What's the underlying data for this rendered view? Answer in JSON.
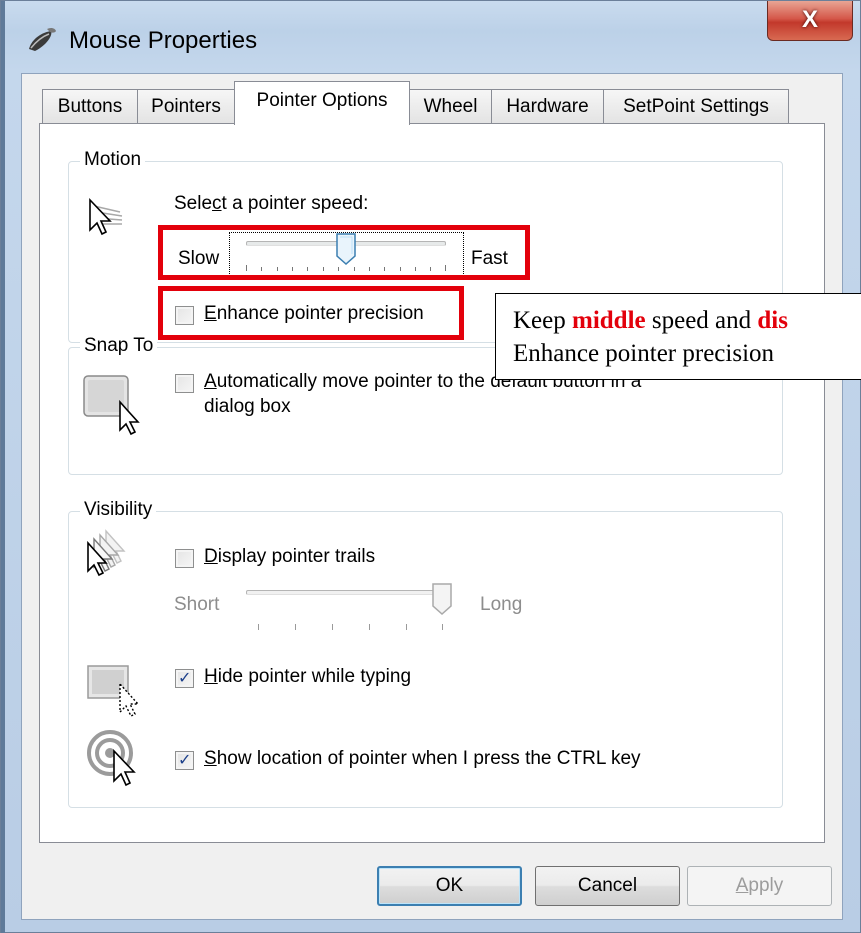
{
  "window": {
    "title": "Mouse Properties",
    "close_label": "X"
  },
  "tabs": [
    {
      "label": "Buttons"
    },
    {
      "label": "Pointers"
    },
    {
      "label": "Pointer Options",
      "active": true
    },
    {
      "label": "Wheel"
    },
    {
      "label": "Hardware"
    },
    {
      "label": "SetPoint Settings"
    }
  ],
  "motion": {
    "group_title": "Motion",
    "speed_label_pre": "Sele",
    "speed_label_key": "c",
    "speed_label_post": "t a pointer speed:",
    "slow_label": "Slow",
    "fast_label": "Fast",
    "speed_fraction": 0.5,
    "enhance_key": "E",
    "enhance_label_post": "nhance pointer precision",
    "enhance_checked": false
  },
  "snap_to": {
    "group_title": "Snap To",
    "auto_key": "A",
    "auto_label_line1_post": "utomatically move pointer to the default button in a",
    "auto_label_line2": "dialog box",
    "auto_checked": false
  },
  "visibility": {
    "group_title": "Visibility",
    "trails_key": "D",
    "trails_label_post": "isplay pointer trails",
    "trails_checked": false,
    "short_label": "Short",
    "long_label": "Long",
    "trails_fraction": 1.0,
    "hide_key": "H",
    "hide_label_post": "ide pointer while typing",
    "hide_checked": true,
    "show_key": "S",
    "show_label_post": "how location of pointer when I press the CTRL key",
    "show_checked": true
  },
  "callout": {
    "line1_pre": "Keep ",
    "line1_em1": "middle",
    "line1_mid": " speed and ",
    "line1_em2": "dis",
    "line2": "Enhance pointer precision"
  },
  "buttons": {
    "ok": "OK",
    "cancel": "Cancel",
    "apply": "Apply"
  },
  "colors": {
    "highlight": "#e3000b",
    "check_mark": "#1c3f8a"
  }
}
